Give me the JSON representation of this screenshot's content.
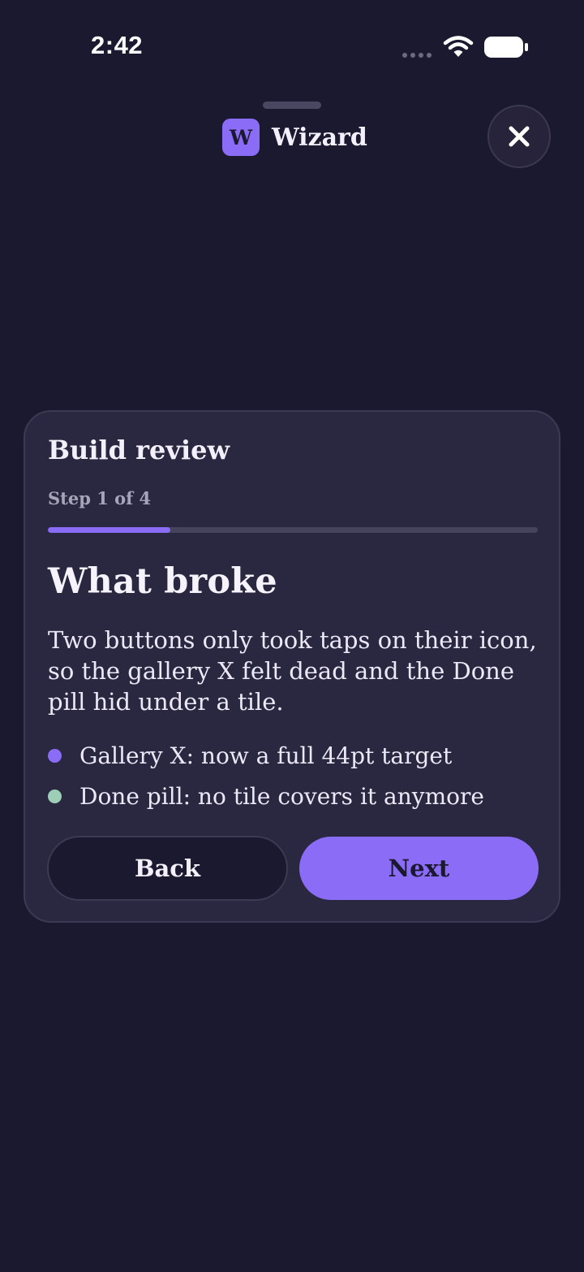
{
  "status_bar": {
    "time": "2:42",
    "icons": [
      "signal-dots-icon",
      "wifi-icon",
      "battery-icon"
    ]
  },
  "header": {
    "logo_letter": "W",
    "app_name": "Wizard",
    "close_icon": "close-icon"
  },
  "card": {
    "title": "Build review",
    "step_label": "Step 1 of 4",
    "progress": {
      "current": 1,
      "total": 4,
      "fraction": 0.25
    },
    "heading": "What broke",
    "body": "Two buttons only took taps on their icon, so the gallery X felt dead and the Done pill hid under a tile.",
    "bullets": [
      {
        "text": "Gallery X: now a full 44pt target",
        "color": "#8b6cf6"
      },
      {
        "text": "Done pill: no tile covers it anymore",
        "color": "#9ccfb6"
      }
    ],
    "back_label": "Back",
    "next_label": "Next"
  },
  "colors": {
    "background": "#1b1930",
    "card": "#2a2740",
    "accent": "#8b6cf6",
    "mint": "#9ccfb6"
  }
}
